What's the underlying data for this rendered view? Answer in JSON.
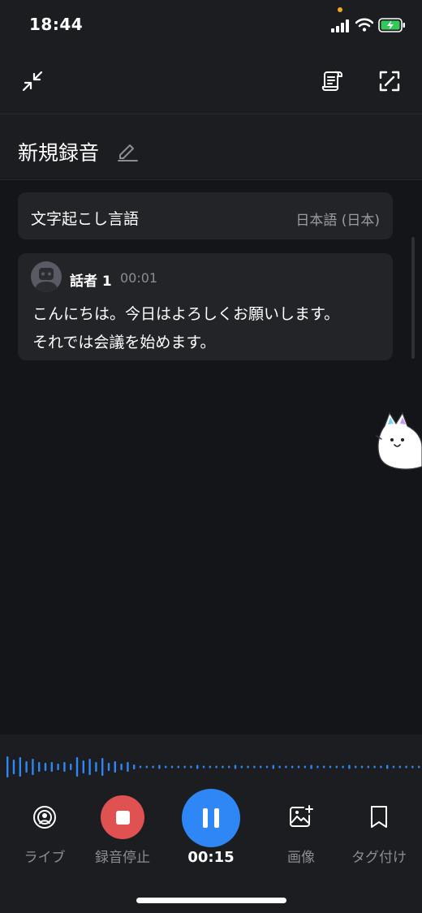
{
  "status": {
    "time": "18:44"
  },
  "title": {
    "text": "新規録音"
  },
  "language": {
    "label": "文字起こし言語",
    "value": "日本語 (日本)"
  },
  "transcript": {
    "speaker": "話者 1",
    "timestamp": "00:01",
    "lines": [
      "こんにちは。今日はよろしくお願いします。",
      "それでは会議を始めます。"
    ]
  },
  "controls": {
    "live_label": "ライブ",
    "stop_label": "録音停止",
    "elapsed": "00:15",
    "image_label": "画像",
    "tag_label": "タグ付け"
  },
  "colors": {
    "background": "#141518",
    "surface": "#232428",
    "accent_blue": "#2f86f5",
    "stop_red": "#e05252"
  },
  "icons": [
    "collapse-icon",
    "notes-icon",
    "expand-icon",
    "edit-icon",
    "live-icon",
    "stop-icon",
    "pause-icon",
    "add-image-icon",
    "bookmark-icon"
  ]
}
